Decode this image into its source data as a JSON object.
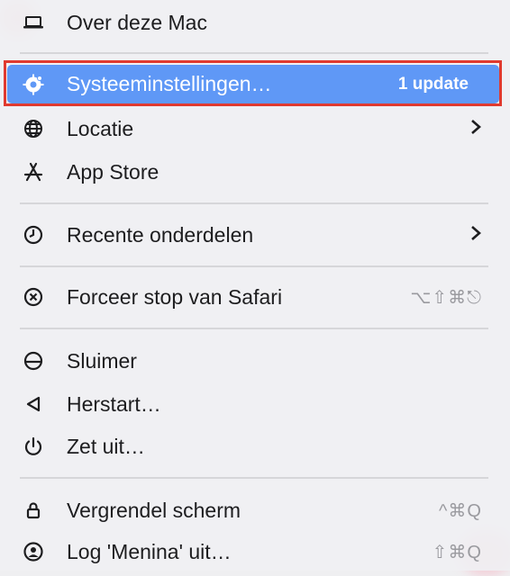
{
  "menu": {
    "about": "Over deze Mac",
    "settings": "Systeeminstellingen…",
    "settings_badge": "1 update",
    "location": "Locatie",
    "appstore": "App Store",
    "recent": "Recente onderdelen",
    "force_quit": "Forceer stop van Safari",
    "force_quit_shortcut": "⌥⇧⌘⎋",
    "sleep": "Sluimer",
    "restart": "Herstart…",
    "shutdown": "Zet uit…",
    "lock": "Vergrendel scherm",
    "lock_shortcut": "^⌘Q",
    "logout": "Log 'Menina' uit…",
    "logout_shortcut": "⇧⌘Q"
  },
  "colors": {
    "highlight": "#5f98f6",
    "focus_ring": "#e03a2f"
  }
}
